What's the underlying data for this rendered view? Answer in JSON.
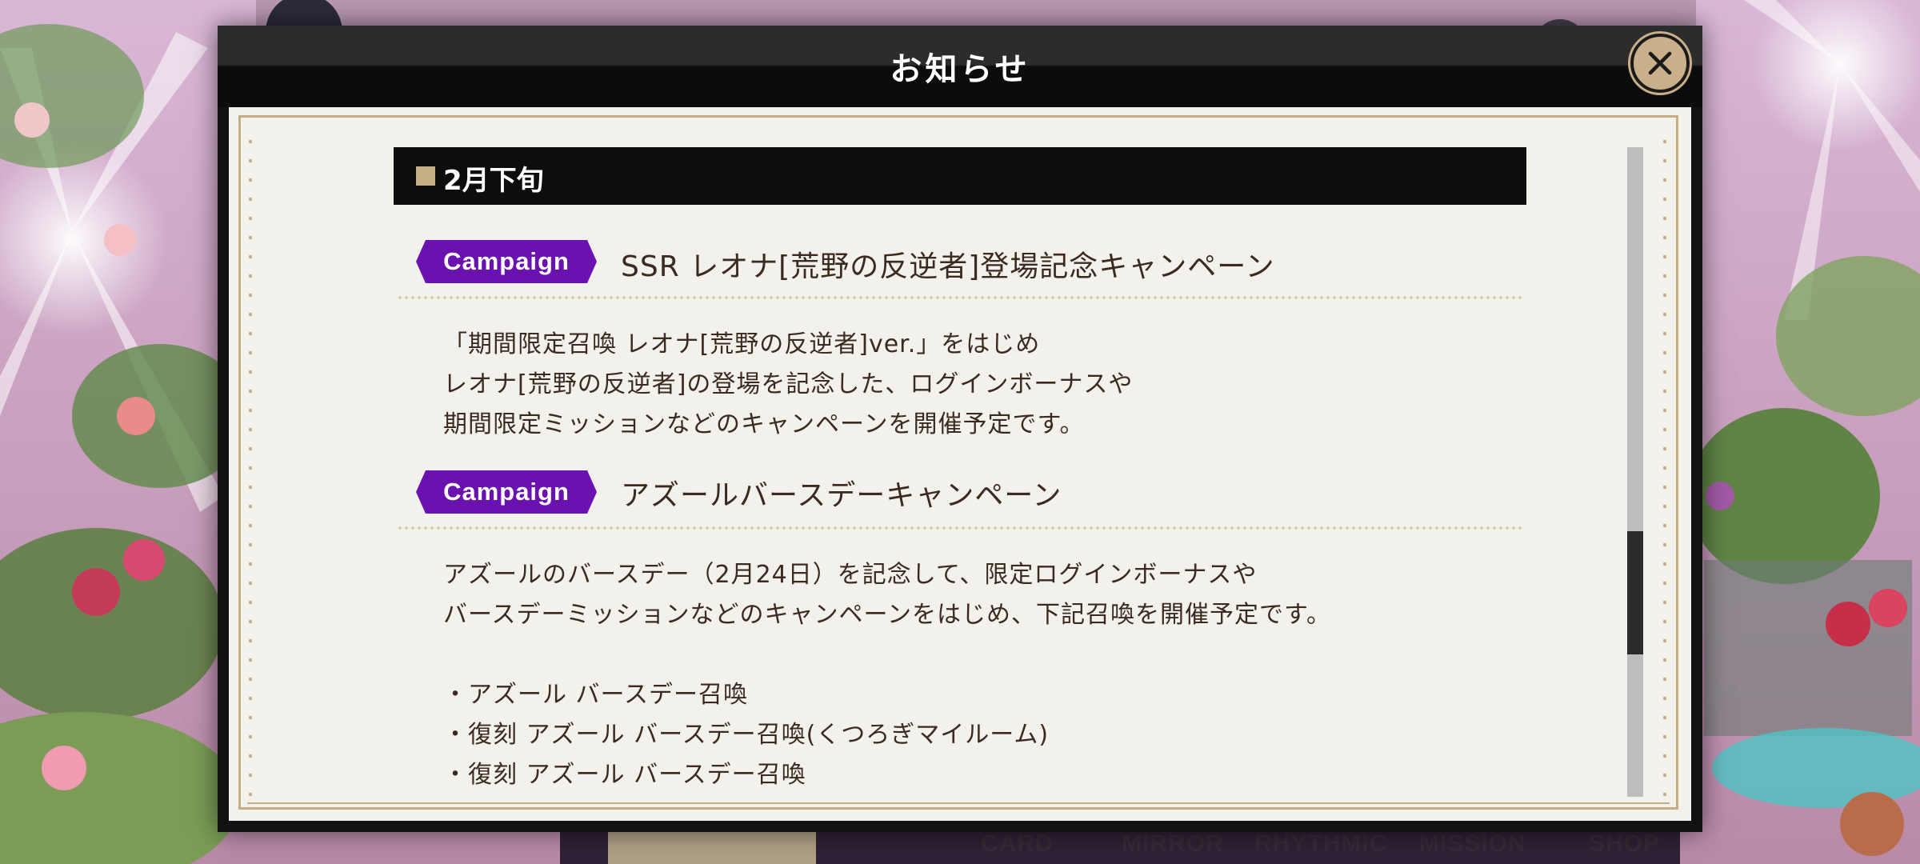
{
  "modal": {
    "title": "お知らせ",
    "close_icon": "close-icon"
  },
  "section": {
    "label": "2月下旬"
  },
  "articles": [
    {
      "tag": "Campaign",
      "title": "SSR レオナ[荒野の反逆者]登場記念キャンペーン",
      "lines": [
        "「期間限定召喚 レオナ[荒野の反逆者]ver.」をはじめ",
        "レオナ[荒野の反逆者]の登場を記念した、ログインボーナスや",
        "期間限定ミッションなどのキャンペーンを開催予定です。"
      ]
    },
    {
      "tag": "Campaign",
      "title": "アズールバースデーキャンペーン",
      "lines": [
        "アズールのバースデー（2月24日）を記念して、限定ログインボーナスや",
        "バースデーミッションなどのキャンペーンをはじめ、下記召喚を開催予定です。",
        "",
        "・アズール バースデー召喚",
        "・復刻 アズール バースデー召喚(くつろぎマイルーム)",
        "・復刻 アズール バースデー召喚"
      ]
    }
  ],
  "bottom_nav": [
    "CARD",
    "MIRROR",
    "RHYTHMIC",
    "MISSION",
    "SHOP"
  ],
  "colors": {
    "campaign_tag": "#6a12b0",
    "section_bar": "#0d0d0d",
    "accent_gold": "#c4ae86",
    "paper": "#f3f1ec"
  }
}
